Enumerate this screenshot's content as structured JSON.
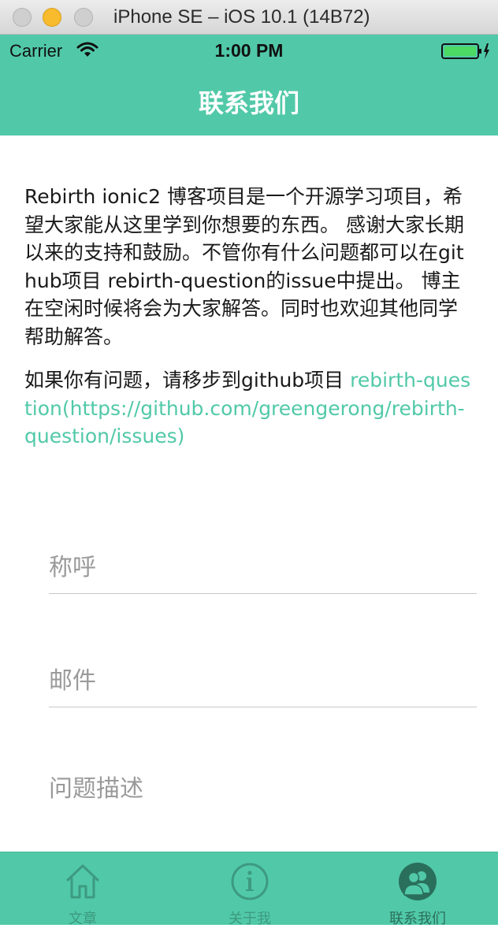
{
  "simulator": {
    "title": "iPhone SE – iOS 10.1 (14B72)"
  },
  "status_bar": {
    "carrier": "Carrier",
    "time": "1:00 PM"
  },
  "navbar": {
    "title": "联系我们"
  },
  "content": {
    "paragraph1": "Rebirth ionic2 博客项目是一个开源学习项目，希望大家能从这里学到你想要的东西。 感谢大家长期以来的支持和鼓励。不管你有什么问题都可以在github项目 rebirth-question的issue中提出。 博主在空闲时候将会为大家解答。同时也欢迎其他同学帮助解答。",
    "paragraph2_prefix": "如果你有问题，请移步到github项目 ",
    "paragraph2_link": "rebirth-question(https://github.com/greengerong/rebirth-question/issues)"
  },
  "form": {
    "name_placeholder": "称呼",
    "email_placeholder": "邮件",
    "description_placeholder": "问题描述"
  },
  "tabs": [
    {
      "label": "文章",
      "icon": "home-icon"
    },
    {
      "label": "关于我",
      "icon": "info-icon"
    },
    {
      "label": "联系我们",
      "icon": "contacts-icon",
      "active": true
    }
  ],
  "colors": {
    "accent": "#51c9a8",
    "link": "#51c9a8",
    "tab_inactive": "#3d9a80",
    "tab_active": "#2a6f5c"
  }
}
